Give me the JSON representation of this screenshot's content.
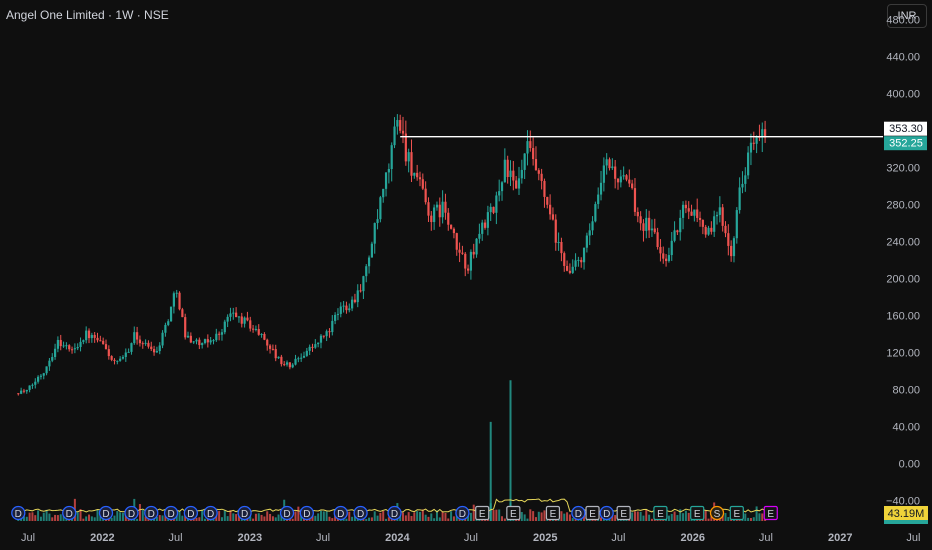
{
  "header": {
    "title": "Angel One Limited · 1W · NSE",
    "currency": "INR"
  },
  "colors": {
    "up": "#26a69a",
    "down": "#ef5350",
    "background": "#0f0f0f",
    "line": "#ffffff",
    "volume_ma": "#e6d75a"
  },
  "chart_data": {
    "type": "candlestick",
    "title": "Angel One Limited · 1W · NSE",
    "ylim": [
      -45,
      505
    ],
    "y_ticks": [
      480,
      440,
      400,
      360,
      320,
      280,
      240,
      200,
      160,
      120,
      80,
      40,
      0,
      -40
    ],
    "y_tick_labels": [
      "480.00",
      "440.00",
      "400.00",
      "360.00",
      "320.00",
      "280.00",
      "240.00",
      "200.00",
      "160.00",
      "120.00",
      "80.00",
      "40.00",
      "0.00",
      "−40.00"
    ],
    "x_ticks": [
      {
        "label": "Jul",
        "date": "2021-07-01"
      },
      {
        "label": "2022",
        "date": "2022-01-01"
      },
      {
        "label": "Jul",
        "date": "2022-07-01"
      },
      {
        "label": "2023",
        "date": "2023-01-01"
      },
      {
        "label": "Jul",
        "date": "2023-07-01"
      },
      {
        "label": "2024",
        "date": "2024-01-01"
      },
      {
        "label": "Jul",
        "date": "2024-07-01"
      },
      {
        "label": "2025",
        "date": "2025-01-01"
      },
      {
        "label": "Jul",
        "date": "2025-07-01"
      },
      {
        "label": "2026",
        "date": "2026-01-01"
      },
      {
        "label": "Jul",
        "date": "2026-07-01"
      },
      {
        "label": "2027",
        "date": "2027-01-01"
      },
      {
        "label": "Jul",
        "date": "2027-07-01"
      }
    ],
    "close_path": [
      [
        "2021-06-28",
        78
      ],
      [
        "2021-08-09",
        100
      ],
      [
        "2021-09-13",
        132
      ],
      [
        "2021-10-18",
        122
      ],
      [
        "2021-11-22",
        140
      ],
      [
        "2022-01-03",
        128
      ],
      [
        "2022-01-31",
        108
      ],
      [
        "2022-02-21",
        112
      ],
      [
        "2022-03-21",
        138
      ],
      [
        "2022-04-18",
        128
      ],
      [
        "2022-05-16",
        122
      ],
      [
        "2022-06-13",
        158
      ],
      [
        "2022-07-04",
        190
      ],
      [
        "2022-07-25",
        138
      ],
      [
        "2022-09-05",
        128
      ],
      [
        "2022-10-17",
        140
      ],
      [
        "2022-11-14",
        162
      ],
      [
        "2022-12-26",
        152
      ],
      [
        "2023-02-06",
        135
      ],
      [
        "2023-03-13",
        112
      ],
      [
        "2023-04-10",
        105
      ],
      [
        "2023-05-15",
        120
      ],
      [
        "2023-06-12",
        128
      ],
      [
        "2023-07-17",
        145
      ],
      [
        "2023-08-14",
        168
      ],
      [
        "2023-09-11",
        175
      ],
      [
        "2023-10-09",
        198
      ],
      [
        "2023-11-13",
        265
      ],
      [
        "2023-12-11",
        320
      ],
      [
        "2024-01-01",
        378
      ],
      [
        "2024-01-22",
        338
      ],
      [
        "2024-02-19",
        305
      ],
      [
        "2024-03-25",
        265
      ],
      [
        "2024-04-22",
        278
      ],
      [
        "2024-05-27",
        232
      ],
      [
        "2024-06-24",
        212
      ],
      [
        "2024-07-29",
        258
      ],
      [
        "2024-08-26",
        272
      ],
      [
        "2024-09-23",
        325
      ],
      [
        "2024-10-21",
        292
      ],
      [
        "2024-11-18",
        340
      ],
      [
        "2024-12-09",
        315
      ],
      [
        "2025-01-06",
        278
      ],
      [
        "2025-02-03",
        232
      ],
      [
        "2025-03-03",
        205
      ],
      [
        "2025-04-07",
        228
      ],
      [
        "2025-05-05",
        272
      ],
      [
        "2025-06-02",
        328
      ],
      [
        "2025-06-30",
        308
      ],
      [
        "2025-07-28",
        298
      ],
      [
        "2025-08-25",
        262
      ],
      [
        "2025-09-22",
        255
      ],
      [
        "2025-10-20",
        218
      ],
      [
        "2025-11-17",
        245
      ],
      [
        "2025-12-15",
        282
      ],
      [
        "2026-01-12",
        268
      ],
      [
        "2026-02-09",
        248
      ],
      [
        "2026-03-09",
        272
      ],
      [
        "2026-04-06",
        232
      ],
      [
        "2026-04-27",
        292
      ],
      [
        "2026-05-18",
        338
      ],
      [
        "2026-06-08",
        347
      ],
      [
        "2026-06-29",
        352.25
      ]
    ],
    "horizontal_line": {
      "value": 353.3,
      "start": "2024-01-08"
    },
    "price_labels": {
      "line": "353.30",
      "last": "352.25"
    },
    "volume": {
      "last_label": "43.19M",
      "spikes": [
        {
          "date": "2024-08-19",
          "value": 45
        },
        {
          "date": "2024-10-07",
          "value": 90
        }
      ]
    },
    "event_markers": [
      {
        "date": "2021-06-07",
        "label": "D",
        "kind": "dividend"
      },
      {
        "date": "2021-10-11",
        "label": "D",
        "kind": "dividend"
      },
      {
        "date": "2022-01-10",
        "label": "D",
        "kind": "dividend"
      },
      {
        "date": "2022-03-14",
        "label": "D",
        "kind": "dividend"
      },
      {
        "date": "2022-05-02",
        "label": "D",
        "kind": "dividend"
      },
      {
        "date": "2022-06-20",
        "label": "D",
        "kind": "dividend"
      },
      {
        "date": "2022-08-08",
        "label": "D",
        "kind": "dividend"
      },
      {
        "date": "2022-09-26",
        "label": "D",
        "kind": "dividend"
      },
      {
        "date": "2022-12-19",
        "label": "D",
        "kind": "dividend"
      },
      {
        "date": "2023-04-03",
        "label": "D",
        "kind": "dividend"
      },
      {
        "date": "2023-05-22",
        "label": "D",
        "kind": "dividend"
      },
      {
        "date": "2023-08-14",
        "label": "D",
        "kind": "dividend"
      },
      {
        "date": "2023-10-02",
        "label": "D",
        "kind": "dividend"
      },
      {
        "date": "2023-12-25",
        "label": "D",
        "kind": "dividend"
      },
      {
        "date": "2024-06-10",
        "label": "D",
        "kind": "dividend"
      },
      {
        "date": "2024-07-29",
        "label": "E",
        "kind": "earnings"
      },
      {
        "date": "2024-10-14",
        "label": "E",
        "kind": "earnings"
      },
      {
        "date": "2025-01-20",
        "label": "E",
        "kind": "earnings"
      },
      {
        "date": "2025-03-24",
        "label": "D",
        "kind": "dividend"
      },
      {
        "date": "2025-04-28",
        "label": "E",
        "kind": "earnings"
      },
      {
        "date": "2025-06-02",
        "label": "D",
        "kind": "dividend"
      },
      {
        "date": "2025-07-14",
        "label": "E",
        "kind": "earnings"
      },
      {
        "date": "2025-10-13",
        "label": "E",
        "kind": "earnings"
      },
      {
        "date": "2026-01-12",
        "label": "E",
        "kind": "earnings"
      },
      {
        "date": "2026-03-02",
        "label": "S",
        "kind": "split"
      },
      {
        "date": "2026-04-20",
        "label": "E",
        "kind": "earnings"
      },
      {
        "date": "2026-07-13",
        "label": "E",
        "kind": "upcoming-earnings"
      }
    ]
  }
}
